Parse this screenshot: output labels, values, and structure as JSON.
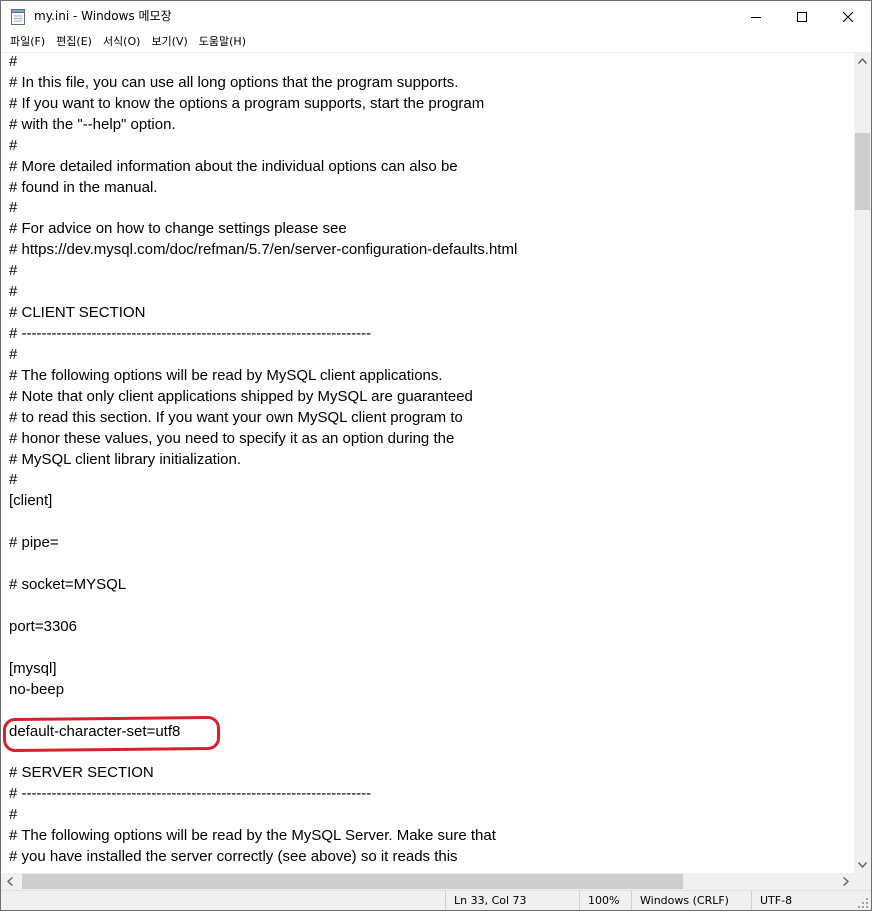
{
  "window": {
    "title": "my.ini - Windows 메모장",
    "icon": "notepad-icon",
    "controls": [
      "minimize-icon",
      "maximize-icon",
      "close-icon"
    ]
  },
  "menu": [
    {
      "label": "파일(F)"
    },
    {
      "label": "편집(E)"
    },
    {
      "label": "서식(O)"
    },
    {
      "label": "보기(V)"
    },
    {
      "label": "도움말(H)"
    }
  ],
  "editor": {
    "lines": [
      "#",
      "# In this file, you can use all long options that the program supports.",
      "# If you want to know the options a program supports, start the program",
      "# with the \"--help\" option.",
      "#",
      "# More detailed information about the individual options can also be",
      "# found in the manual.",
      "#",
      "# For advice on how to change settings please see",
      "# https://dev.mysql.com/doc/refman/5.7/en/server-configuration-defaults.html",
      "#",
      "#",
      "# CLIENT SECTION",
      "# ----------------------------------------------------------------------",
      "#",
      "# The following options will be read by MySQL client applications.",
      "# Note that only client applications shipped by MySQL are guaranteed",
      "# to read this section. If you want your own MySQL client program to",
      "# honor these values, you need to specify it as an option during the",
      "# MySQL client library initialization.",
      "#",
      "[client]",
      "",
      "# pipe=",
      "",
      "# socket=MYSQL",
      "",
      "port=3306",
      "",
      "[mysql]",
      "no-beep",
      "",
      "default-character-set=utf8",
      "",
      "# SERVER SECTION",
      "# ----------------------------------------------------------------------",
      "#",
      "# The following options will be read by the MySQL Server. Make sure that",
      "# you have installed the server correctly (see above) so it reads this"
    ],
    "annotation_color": "#d8202a"
  },
  "status": {
    "position": "Ln 33, Col 73",
    "zoom": "100%",
    "line_ending": "Windows (CRLF)",
    "encoding": "UTF-8"
  }
}
